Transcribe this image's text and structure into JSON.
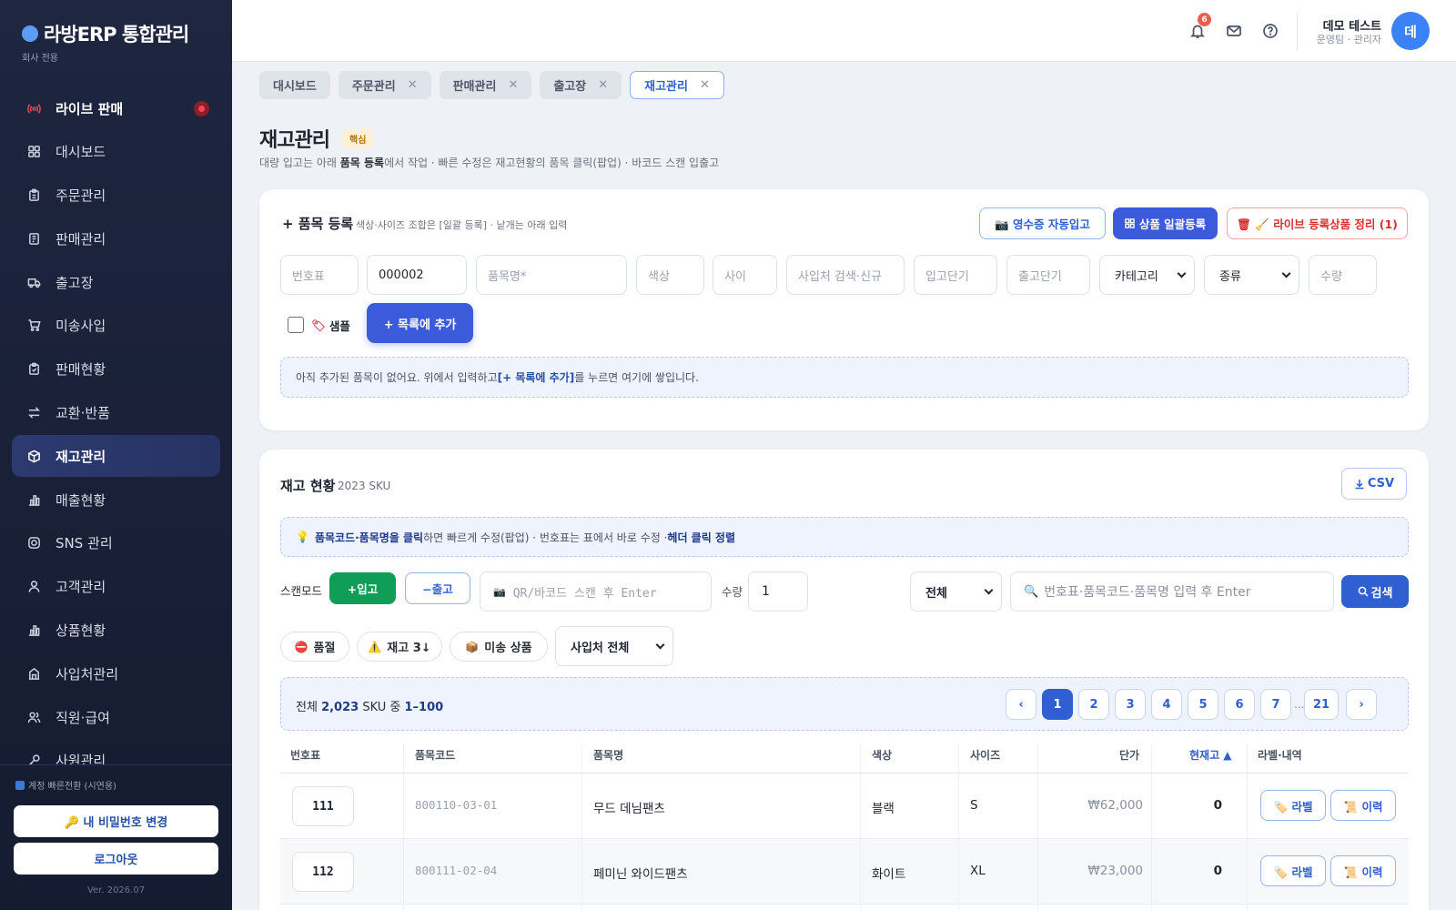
{
  "sidebar": {
    "brand_title": "라방ERP 통합관리",
    "brand_sub": "회사 전용",
    "items": [
      {
        "label": "라이브 판매",
        "icon": "live-broadcast-icon"
      },
      {
        "label": "대시보드",
        "icon": "grid-icon"
      },
      {
        "label": "주문관리",
        "icon": "clipboard-icon"
      },
      {
        "label": "판매관리",
        "icon": "document-icon"
      },
      {
        "label": "출고장",
        "icon": "truck-icon"
      },
      {
        "label": "미송사입",
        "icon": "cart-icon"
      },
      {
        "label": "판매현황",
        "icon": "clipboard-check-icon"
      },
      {
        "label": "교환·반품",
        "icon": "swap-icon"
      },
      {
        "label": "재고관리",
        "icon": "box-icon"
      },
      {
        "label": "매출현황",
        "icon": "bar-chart-icon"
      },
      {
        "label": "SNS 관리",
        "icon": "instagram-icon"
      },
      {
        "label": "고객관리",
        "icon": "user-icon"
      },
      {
        "label": "상품현황",
        "icon": "bar-chart-icon"
      },
      {
        "label": "사입처관리",
        "icon": "building-icon"
      },
      {
        "label": "직원·급여",
        "icon": "users-icon"
      },
      {
        "label": "사원관리",
        "icon": "key-icon"
      }
    ],
    "quick_switch": "계정 빠른전환 (시연용)",
    "change_pw": "🔑 내 비밀번호 변경",
    "logout": "로그아웃",
    "version": "Ver. 2026.07"
  },
  "topbar": {
    "notif_count": "6",
    "user_name": "데모 테스트",
    "user_role": "운영팀 · 관리자",
    "avatar_text": "데"
  },
  "tabs": [
    {
      "label": "대시보드"
    },
    {
      "label": "주문관리",
      "close": "✕"
    },
    {
      "label": "판매관리",
      "close": "✕"
    },
    {
      "label": "출고장",
      "close": "✕"
    },
    {
      "label": "재고관리",
      "close": "✕"
    }
  ],
  "page": {
    "title": "재고관리",
    "badge": "핵심",
    "desc_1": "대량 입고는 아래 ",
    "desc_bold": "품목 등록",
    "desc_2": "에서 작업 · 빠른 수정은 재고현황의 품목 클릭(팝업) · 바코드 스캔 입출고"
  },
  "register": {
    "title": "+ 품목 등록",
    "sub": "색상·사이즈 조합은 [일괄 등록] · 낱개는 아래 입력",
    "receipt_btn": "📷 영수증 자동입고",
    "bulk_btn": "상품 일괄등록",
    "cleanup_btn": "🗑 🧹 라이브 등록상품 정리 (1)",
    "fields": {
      "tag_placeholder": "번호표",
      "code_value": "000002",
      "name_placeholder": "품목명*",
      "color_placeholder": "색상",
      "size_placeholder": "사이",
      "vendor_placeholder": "사입처 검색·신규",
      "in_price_placeholder": "입고단기",
      "out_price_placeholder": "출고단기",
      "category_selected": "카테고리",
      "type_selected": "종류",
      "qty_placeholder": "수량"
    },
    "sample_label": "샘플",
    "add_btn": "+ 목록에 추가",
    "empty_1": "아직 추가된 품목이 없어요. 위에서 입력하고 ",
    "empty_bold": "[+ 목록에 추가]",
    "empty_2": "를 누르면 여기에 쌓입니다."
  },
  "inventory": {
    "title": "재고 현황",
    "count": "2023 SKU",
    "csv_btn": "CSV",
    "tip_icon": "💡",
    "tip_bold": "품목코드·품목명을 클릭",
    "tip_text": "하면 빠르게 수정(팝업) · 번호표는 표에서 바로 수정 · ",
    "tip_bold2": "헤더 클릭 정렬",
    "scan_label": "스캔모드",
    "in_btn": "+입고",
    "out_btn": "−출고",
    "qr_placeholder": "QR/바코드 스캔 후 Enter",
    "qty_label": "수량",
    "qty_value": "1",
    "filter_selected": "전체",
    "search_placeholder": "번호표·품목코드·품목명 입력 후 Enter",
    "search_btn": "검색",
    "chips": [
      {
        "label": "품절",
        "icon": "⛔"
      },
      {
        "label": "재고 3↓",
        "icon": "⚠️"
      },
      {
        "label": "미송 상품",
        "icon": "📦"
      }
    ],
    "vendor_filter": "사입처 전체",
    "pager_prefix": "전체 ",
    "pager_total": "2,023",
    "pager_mid": " SKU 중 ",
    "pager_range": "1–100",
    "pages": [
      "1",
      "2",
      "3",
      "4",
      "5",
      "6",
      "7"
    ],
    "pages_dots": "...",
    "last_page": "21",
    "prev": "‹",
    "next": "›",
    "columns": [
      "번호표",
      "품목코드",
      "품목명",
      "색상",
      "사이즈",
      "단가",
      "현재고 ▲",
      "라벨·내역"
    ],
    "rows": [
      {
        "tag": "111",
        "code": "800110-03-01",
        "name": "무드 데님팬츠",
        "color": "블랙",
        "size": "S",
        "price": "₩62,000",
        "stock": "0"
      },
      {
        "tag": "112",
        "code": "800111-02-04",
        "name": "페미닌 와이드팬츠",
        "color": "화이트",
        "size": "XL",
        "price": "₩23,000",
        "stock": "0"
      }
    ],
    "label_btn": "🏷️ 라벨",
    "history_btn": "📜 이력"
  }
}
